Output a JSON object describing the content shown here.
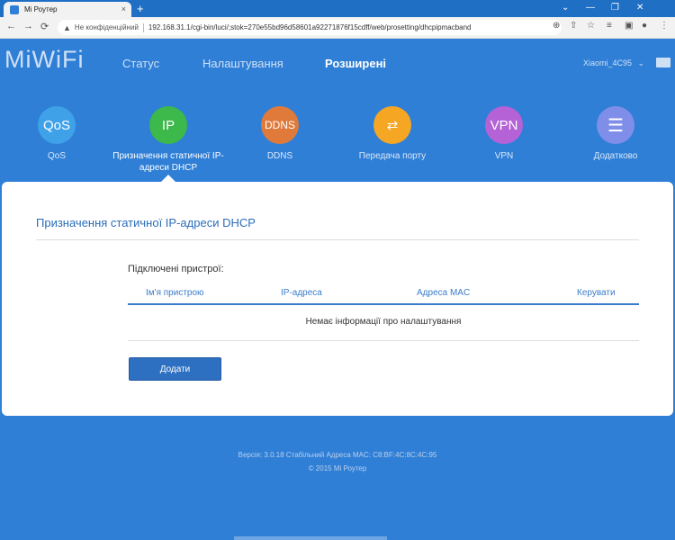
{
  "browser": {
    "tab_title": "Mi Роутер",
    "tab_close": "×",
    "new_tab": "+",
    "win_controls": [
      "⌄",
      "—",
      "❐",
      "✕"
    ],
    "nav_icons": [
      "←",
      "→",
      "⟳"
    ],
    "security_icon": "▲",
    "security_text": "Не конфіденційний",
    "url": "192.168.31.1/cgi-bin/luci/;stok=270e55bd96d58601a92271876f15cdff/web/prosetting/dhcpipmacband",
    "right_icons": [
      "⊕",
      "⇧",
      "☆",
      "≡",
      "▣",
      "●",
      "⋮"
    ]
  },
  "header": {
    "logo": "MiWiFi",
    "menu": [
      "Статус",
      "Налаштування",
      "Розширені"
    ],
    "active_menu": "Розширені",
    "router_name": "Xiaomi_4C95",
    "chevron": "⌄"
  },
  "apps": [
    {
      "icon": "QoS",
      "label": "QoS",
      "color": "#3fa1e8"
    },
    {
      "icon": "IP",
      "label": "Призначення статичної IP-адреси DHCP",
      "color": "#3db84a"
    },
    {
      "icon": "DDNS",
      "label": "DDNS",
      "color": "#e07a3a"
    },
    {
      "icon": "⇄",
      "label": "Передача порту",
      "color": "#f5a623"
    },
    {
      "icon": "VPN",
      "label": "VPN",
      "color": "#b462d6"
    },
    {
      "icon": "☰",
      "label": "Додатково",
      "color": "#7f8ee8"
    }
  ],
  "panel": {
    "title": "Призначення статичної IP-адреси DHCP",
    "subtitle": "Підключені пристрої:",
    "columns": [
      "Ім'я пристрою",
      "IP-адреса",
      "Адреса MAC",
      "Керувати"
    ],
    "empty_text": "Немає інформації про налаштування",
    "add_button": "Додати"
  },
  "footer": {
    "version_line": "Версія: 3.0.18 Стабільний  Адреса MAC: C8:BF:4C:8C:4C:95",
    "copyright": "© 2015 Mi Роутер"
  }
}
